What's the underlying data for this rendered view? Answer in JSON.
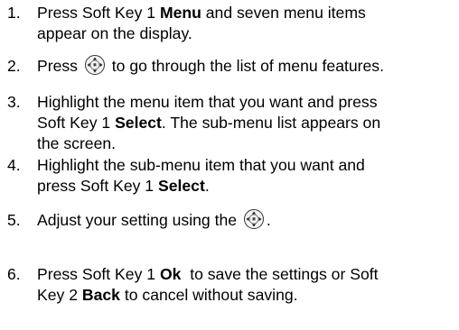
{
  "steps": [
    {
      "number": "1.",
      "lines": [
        {
          "before": "Press Soft Key 1 ",
          "bold": "Menu",
          "after": " and seven menu items"
        },
        {
          "before": "appear on the display."
        }
      ]
    },
    {
      "number": "2.",
      "lines": [
        {
          "before": "Press ",
          "icon": "navigation-key-icon",
          "after": " to go through the list of menu features."
        }
      ]
    },
    {
      "number": "3.",
      "lines": [
        {
          "before": "Highlight the menu item that you want and press"
        },
        {
          "before": "Soft Key 1 ",
          "bold": "Select",
          "after": ". The sub-menu list appears on"
        },
        {
          "before": "the screen."
        }
      ]
    },
    {
      "number": "4.",
      "lines": [
        {
          "before": "Highlight the sub-menu item that you want and"
        },
        {
          "before": "press Soft Key 1 ",
          "bold": "Select",
          "after": "."
        }
      ]
    },
    {
      "number": "5.",
      "lines": [
        {
          "before": "Adjust your setting using the ",
          "icon": "navigation-key-icon",
          "after": "."
        }
      ]
    },
    {
      "number": "6.",
      "lines": [
        {
          "before": "Press Soft Key 1 ",
          "bold": "Ok",
          "after": "  to save the settings or Soft"
        },
        {
          "before": "Key 2 ",
          "bold": "Back",
          "after": " to cancel without saving."
        }
      ]
    }
  ]
}
